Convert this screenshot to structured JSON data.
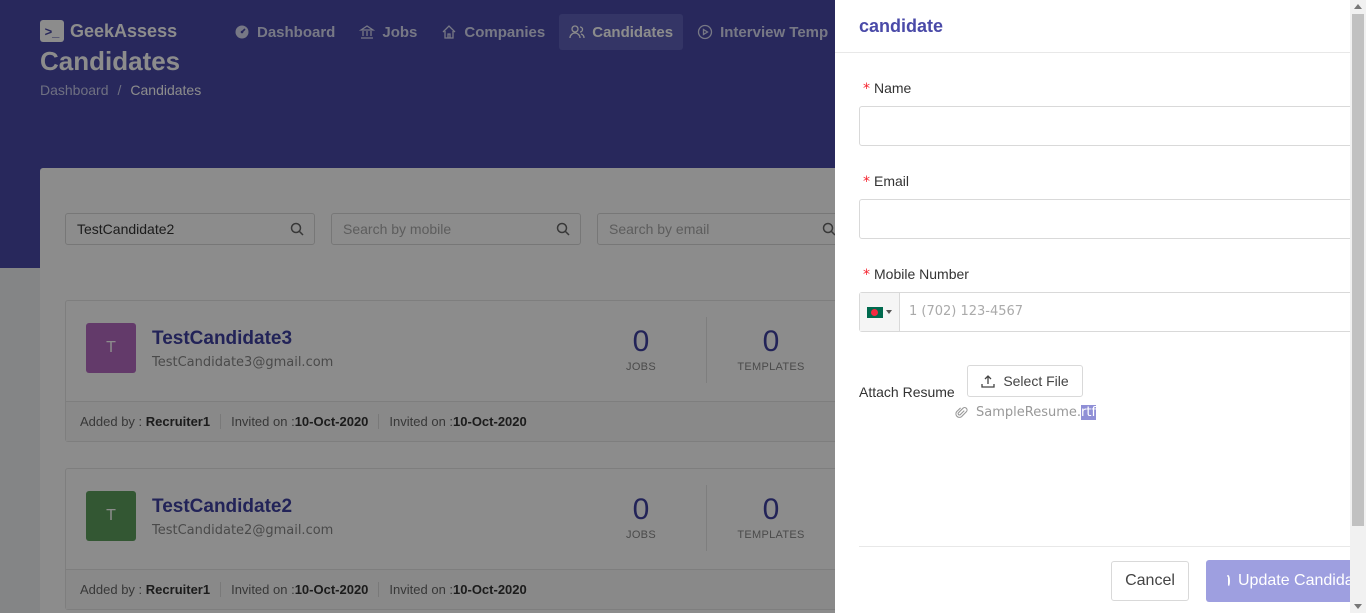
{
  "app": {
    "logo_text": "GeekAssess",
    "logo_glyph": ">_"
  },
  "nav": [
    {
      "label": "Dashboard",
      "icon": "dashboard-icon"
    },
    {
      "label": "Jobs",
      "icon": "bank-icon"
    },
    {
      "label": "Companies",
      "icon": "home-icon"
    },
    {
      "label": "Candidates",
      "icon": "users-icon",
      "active": true
    },
    {
      "label": "Interview Temp",
      "icon": "play-circle-icon"
    }
  ],
  "page": {
    "title": "Candidates",
    "breadcrumb": [
      "Dashboard",
      "/",
      "Candidates"
    ]
  },
  "filters": {
    "name_value": "TestCandidate2",
    "mobile_placeholder": "Search by mobile",
    "email_placeholder": "Search by email"
  },
  "candidates": [
    {
      "initial": "T",
      "avatar_color": "#b56bc1",
      "name": "TestCandidate3",
      "email": "TestCandidate3@gmail.com",
      "jobs": "0",
      "jobs_label": "JOBS",
      "templates": "0",
      "templates_label": "TEMPLATES",
      "added_by_label": "Added by : ",
      "added_by": "Recruiter1",
      "invited_label_1": "Invited on :",
      "invited_1": "10-Oct-2020",
      "invited_label_2": "Invited on :",
      "invited_2": "10-Oct-2020"
    },
    {
      "initial": "T",
      "avatar_color": "#5e9e5e",
      "name": "TestCandidate2",
      "email": "TestCandidate2@gmail.com",
      "jobs": "0",
      "jobs_label": "JOBS",
      "templates": "0",
      "templates_label": "TEMPLATES",
      "added_by_label": "Added by : ",
      "added_by": "Recruiter1",
      "invited_label_1": "Invited on :",
      "invited_1": "10-Oct-2020",
      "invited_label_2": "Invited on :",
      "invited_2": "10-Oct-2020"
    }
  ],
  "drawer": {
    "title": "candidate",
    "name_label": "Name",
    "email_label": "Email",
    "mobile_label": "Mobile Number",
    "mobile_placeholder": "1 (702) 123-4567",
    "required_mark": "*",
    "attach_label": "Attach Resume",
    "select_file_label": "Select File",
    "file_name_base": "SampleResume.",
    "file_name_ext": "rtf",
    "cancel_label": "Cancel",
    "update_label": "Update Candidate"
  },
  "colors": {
    "primary": "#4a4aa8",
    "hero": "#4a4aa8",
    "nav_active": "#5f61bb",
    "required": "#f5222d"
  }
}
